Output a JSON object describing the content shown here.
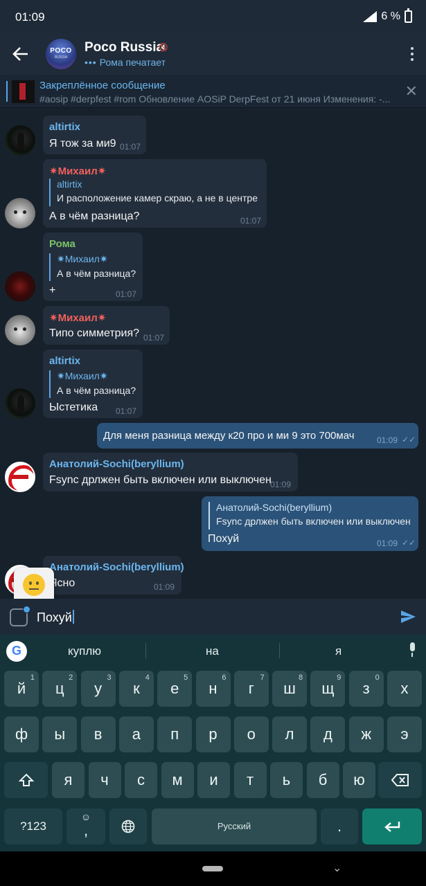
{
  "status_bar": {
    "time": "01:09",
    "battery": "6 %"
  },
  "header": {
    "title": "Poco Russia",
    "typing_dots": "•••",
    "typing_text": "Рома печатает",
    "avatar_text": "POCO",
    "avatar_subtext": "RUSSIA"
  },
  "pinned": {
    "title": "Закреплённое сообщение",
    "text": "#aosip #derpfest #rom Обновление AOSiP DerpFest от 21 июня  Изменения: -..."
  },
  "messages": [
    {
      "sender": "altirtix",
      "text": "Я тож за ми9",
      "time": "01:07"
    },
    {
      "sender": "✷Михаил✷",
      "reply_name": "altirtix",
      "reply_text": "И расположение камер скраю, а не в центре",
      "text": "А в чём разница?",
      "time": "01:07"
    },
    {
      "sender": "Рома",
      "reply_name": "✷Михаил✷",
      "reply_text": "А в чём разница?",
      "text": "+",
      "time": "01:07"
    },
    {
      "sender": "✷Михаил✷",
      "text": "Типо симметрия?",
      "time": "01:07"
    },
    {
      "sender": "altirtix",
      "reply_name": "✷Михаил✷",
      "reply_text": "А в чём разница?",
      "text": "Ыстетика",
      "time": "01:07"
    },
    {
      "text": "Для меня разница между к20 про и ми 9 это 700мач",
      "time": "01:09",
      "status": "✓✓"
    },
    {
      "sender": "Анатолий-Sochi(beryllium)",
      "text": "Fsync дрлжен быть включен или выключен",
      "time": "01:09"
    },
    {
      "reply_name": "Анатолий-Sochi(beryllium)",
      "reply_text": "Fsync дрлжен быть включен или выключен",
      "text": "Похуй",
      "time": "01:09",
      "status": "✓✓"
    },
    {
      "sender": "Анатолий-Sochi(beryllium)",
      "text": "Ясно",
      "time": "01:09"
    }
  ],
  "input": {
    "value": "Похуй"
  },
  "keyboard": {
    "google": "G",
    "suggestions": [
      "куплю",
      "на",
      "я"
    ],
    "row1": [
      {
        "label": "й",
        "hint": "1"
      },
      {
        "label": "ц",
        "hint": "2"
      },
      {
        "label": "у",
        "hint": "3"
      },
      {
        "label": "к",
        "hint": "4"
      },
      {
        "label": "е",
        "hint": "5"
      },
      {
        "label": "н",
        "hint": "6"
      },
      {
        "label": "г",
        "hint": "7"
      },
      {
        "label": "ш",
        "hint": "8"
      },
      {
        "label": "щ",
        "hint": "9"
      },
      {
        "label": "з",
        "hint": "0"
      },
      {
        "label": "х",
        "hint": ""
      }
    ],
    "row2": [
      "ф",
      "ы",
      "в",
      "а",
      "п",
      "р",
      "о",
      "л",
      "д",
      "ж",
      "э"
    ],
    "row3": [
      "я",
      "ч",
      "с",
      "м",
      "и",
      "т",
      "ь",
      "б",
      "ю"
    ],
    "symbols_label": "?123",
    "emoji_key": "☺",
    "comma": ",",
    "space_label": "Русский",
    "period": "."
  }
}
